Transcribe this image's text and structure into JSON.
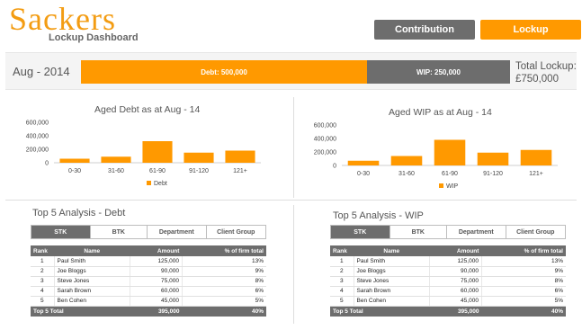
{
  "header": {
    "brand": "Sackers",
    "subtitle": "Lockup Dashboard",
    "nav": [
      {
        "label": "Contribution",
        "active": false
      },
      {
        "label": "Lockup",
        "active": true
      }
    ]
  },
  "summary": {
    "period": "Aug - 2014",
    "debt_label": "Debt: 500,000",
    "wip_label": "WIP: 250,000",
    "debt_value": 500000,
    "wip_value": 250000,
    "total_line1": "Total Lockup:",
    "total_line2": "£750,000",
    "colors": {
      "debt": "#ff9900",
      "wip": "#6d6d6d"
    }
  },
  "chart_data": [
    {
      "type": "bar",
      "title": "Aged Debt as at Aug - 14",
      "categories": [
        "0-30",
        "31-60",
        "61-90",
        "91-120",
        "121+"
      ],
      "series": [
        {
          "name": "Debt",
          "values": [
            60000,
            90000,
            320000,
            150000,
            180000
          ]
        }
      ],
      "ylim": [
        0,
        600000
      ],
      "yticks": [
        "600,000",
        "400,000",
        "200,000",
        "0"
      ],
      "ytick_values": [
        600000,
        400000,
        200000,
        0
      ],
      "grid": false,
      "legend": "bottom",
      "color": "#ff9900"
    },
    {
      "type": "bar",
      "title": "Aged WIP as at Aug - 14",
      "categories": [
        "0-30",
        "31-60",
        "61-90",
        "91-120",
        "121+"
      ],
      "series": [
        {
          "name": "WIP",
          "values": [
            70000,
            140000,
            380000,
            190000,
            230000
          ]
        }
      ],
      "ylim": [
        0,
        600000
      ],
      "yticks": [
        "600,000",
        "400,000",
        "200,000",
        "0"
      ],
      "ytick_values": [
        600000,
        400000,
        200000,
        0
      ],
      "grid": false,
      "legend": "bottom",
      "color": "#ff9900"
    }
  ],
  "tabs": [
    "STK",
    "BTK",
    "Department",
    "Client Group"
  ],
  "tables": [
    {
      "title": "Top 5 Analysis - Debt",
      "columns": [
        "Rank",
        "Name",
        "Amount",
        "% of firm total"
      ],
      "rows": [
        [
          "1",
          "Paul Smith",
          "125,000",
          "13%"
        ],
        [
          "2",
          "Joe Bloggs",
          "90,000",
          "9%"
        ],
        [
          "3",
          "Steve Jones",
          "75,000",
          "8%"
        ],
        [
          "4",
          "Sarah Brown",
          "60,000",
          "6%"
        ],
        [
          "5",
          "Ben Cohen",
          "45,000",
          "5%"
        ]
      ],
      "footer": [
        "Top 5 Total",
        "395,000",
        "40%"
      ]
    },
    {
      "title": "Top 5 Analysis - WIP",
      "columns": [
        "Rank",
        "Name",
        "Amount",
        "% of firm total"
      ],
      "rows": [
        [
          "1",
          "Paul Smith",
          "125,000",
          "13%"
        ],
        [
          "2",
          "Joe Bloggs",
          "90,000",
          "9%"
        ],
        [
          "3",
          "Steve Jones",
          "75,000",
          "8%"
        ],
        [
          "4",
          "Sarah Brown",
          "60,000",
          "6%"
        ],
        [
          "5",
          "Ben Cohen",
          "45,000",
          "5%"
        ]
      ],
      "footer": [
        "Top 5 Total",
        "395,000",
        "40%"
      ]
    }
  ]
}
